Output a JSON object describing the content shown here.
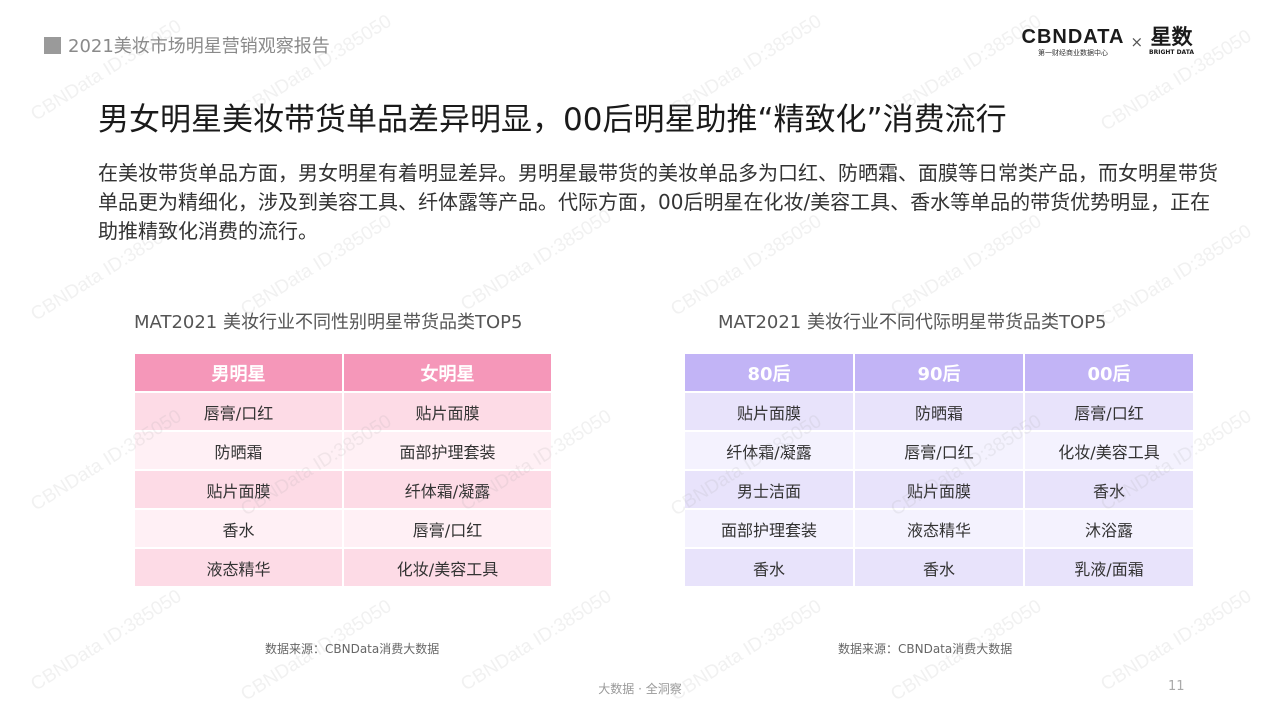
{
  "header": {
    "report_title": "2021美妆市场明星营销观察报告",
    "logo_primary": "CBNDATA",
    "logo_primary_sub": "第一财经商业数据中心",
    "logo_separator": "×",
    "logo_secondary": "星数",
    "logo_secondary_sub": "BRIGHT DATA"
  },
  "main_title": "男女明星美妆带货单品差异明显，00后明星助推“精致化”消费流行",
  "description": "在美妆带货单品方面，男女明星有着明显差异。男明星最带货的美妆单品多为口红、防晒霜、面膜等日常类产品，而女明星带货单品更为精细化，涉及到美容工具、纤体露等产品。代际方面，00后明星在化妆/美容工具、香水等单品的带货优势明显，正在助推精致化消费的流行。",
  "gender_table": {
    "title": "MAT2021 美妆行业不同性别明星带货品类TOP5",
    "headers": [
      "男明星",
      "女明星"
    ],
    "rows": [
      [
        "唇膏/口红",
        "贴片面膜"
      ],
      [
        "防晒霜",
        "面部护理套装"
      ],
      [
        "贴片面膜",
        "纤体霜/凝露"
      ],
      [
        "香水",
        "唇膏/口红"
      ],
      [
        "液态精华",
        "化妆/美容工具"
      ]
    ],
    "source": "数据来源：CBNData消费大数据"
  },
  "generation_table": {
    "title": "MAT2021 美妆行业不同代际明星带货品类TOP5",
    "headers": [
      "80后",
      "90后",
      "00后"
    ],
    "rows": [
      [
        "贴片面膜",
        "防晒霜",
        "唇膏/口红"
      ],
      [
        "纤体霜/凝露",
        "唇膏/口红",
        "化妆/美容工具"
      ],
      [
        "男士洁面",
        "贴片面膜",
        "香水"
      ],
      [
        "面部护理套装",
        "液态精华",
        "沐浴露"
      ],
      [
        "香水",
        "香水",
        "乳液/面霜"
      ]
    ],
    "source": "数据来源：CBNData消费大数据"
  },
  "watermark_text": "CBNData ID:385050",
  "footer": {
    "center_text": "大数据 · 全洞察",
    "page_number": "11"
  }
}
